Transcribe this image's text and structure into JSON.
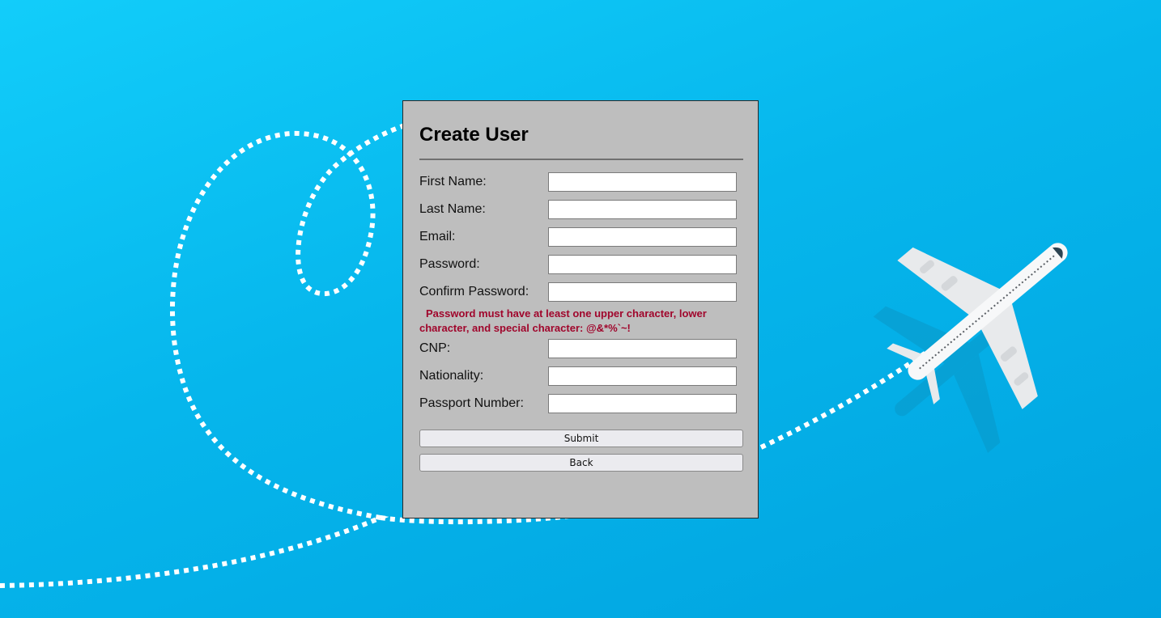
{
  "form": {
    "title": "Create User",
    "fields": [
      {
        "label": "First Name:",
        "value": ""
      },
      {
        "label": "Last Name:",
        "value": ""
      },
      {
        "label": "Email:",
        "value": ""
      },
      {
        "label": "Password:",
        "value": ""
      },
      {
        "label": "Confirm Password:",
        "value": ""
      },
      {
        "label": "CNP:",
        "value": ""
      },
      {
        "label": "Nationality:",
        "value": ""
      },
      {
        "label": "Passport Number:",
        "value": ""
      }
    ],
    "password_hint": "Password must have at least one upper character, lower character, and special character: @&*%`~!",
    "submit_label": "Submit",
    "back_label": "Back"
  },
  "colors": {
    "background": "#06b6ec",
    "panel": "#bebebe",
    "hint": "#a0062c"
  },
  "background_icons": [
    "dotted-flight-path",
    "airplane-icon"
  ]
}
